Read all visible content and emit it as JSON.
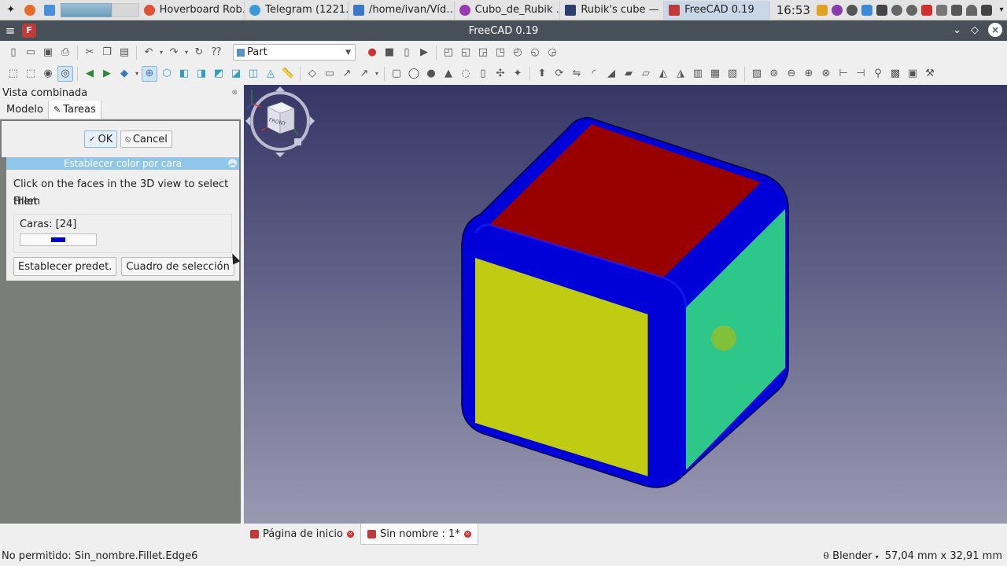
{
  "taskbar": {
    "tasks": [
      {
        "label": "Hoverboard Rob…",
        "color": "#e0533a"
      },
      {
        "label": "Telegram (1221…",
        "color": "#3a9ad8"
      },
      {
        "label": "/home/ivan/Víd…",
        "color": "#3a78c8"
      },
      {
        "label": "Cubo_de_Rubik …",
        "color": "#9a3ab0"
      },
      {
        "label": "Rubik's cube  — …",
        "color": "#2c3e6e"
      },
      {
        "label": "FreeCAD 0.19",
        "color": "#c13a3a"
      }
    ],
    "clock": "16:53"
  },
  "window": {
    "title": "FreeCAD 0.19"
  },
  "toolbar": {
    "workbench": "Part"
  },
  "combo": {
    "header": "Vista combinada",
    "tab_model": "Modelo",
    "tab_tasks": "Tareas",
    "ok_label": "OK",
    "cancel_label": "Cancel",
    "panel_title": "Establecer color por cara",
    "instruction": "Click on the faces in the 3D view to select them",
    "object": "Fillet",
    "faces": "Caras: [24]",
    "face_color": "#0000cc",
    "btn_default": "Establecer predet.",
    "btn_box": "Cuadro de selección"
  },
  "viewport": {
    "navcube_label": "FRONT",
    "colors": {
      "frame": "#0000d8",
      "top": "#990000",
      "front": "#c0cc12",
      "right": "#2ec78a",
      "highlight": "#8abf32",
      "bg_top": "#353665",
      "bg_bottom": "#9999b2"
    }
  },
  "doc_tabs": [
    {
      "label": "Página de inicio"
    },
    {
      "label": "Sin nombre : 1*"
    }
  ],
  "status": {
    "message": "No permitido: Sin_nombre.Fillet.Edge6",
    "navigation": "Blender",
    "dimensions": "57,04 mm x 32,91 mm"
  }
}
